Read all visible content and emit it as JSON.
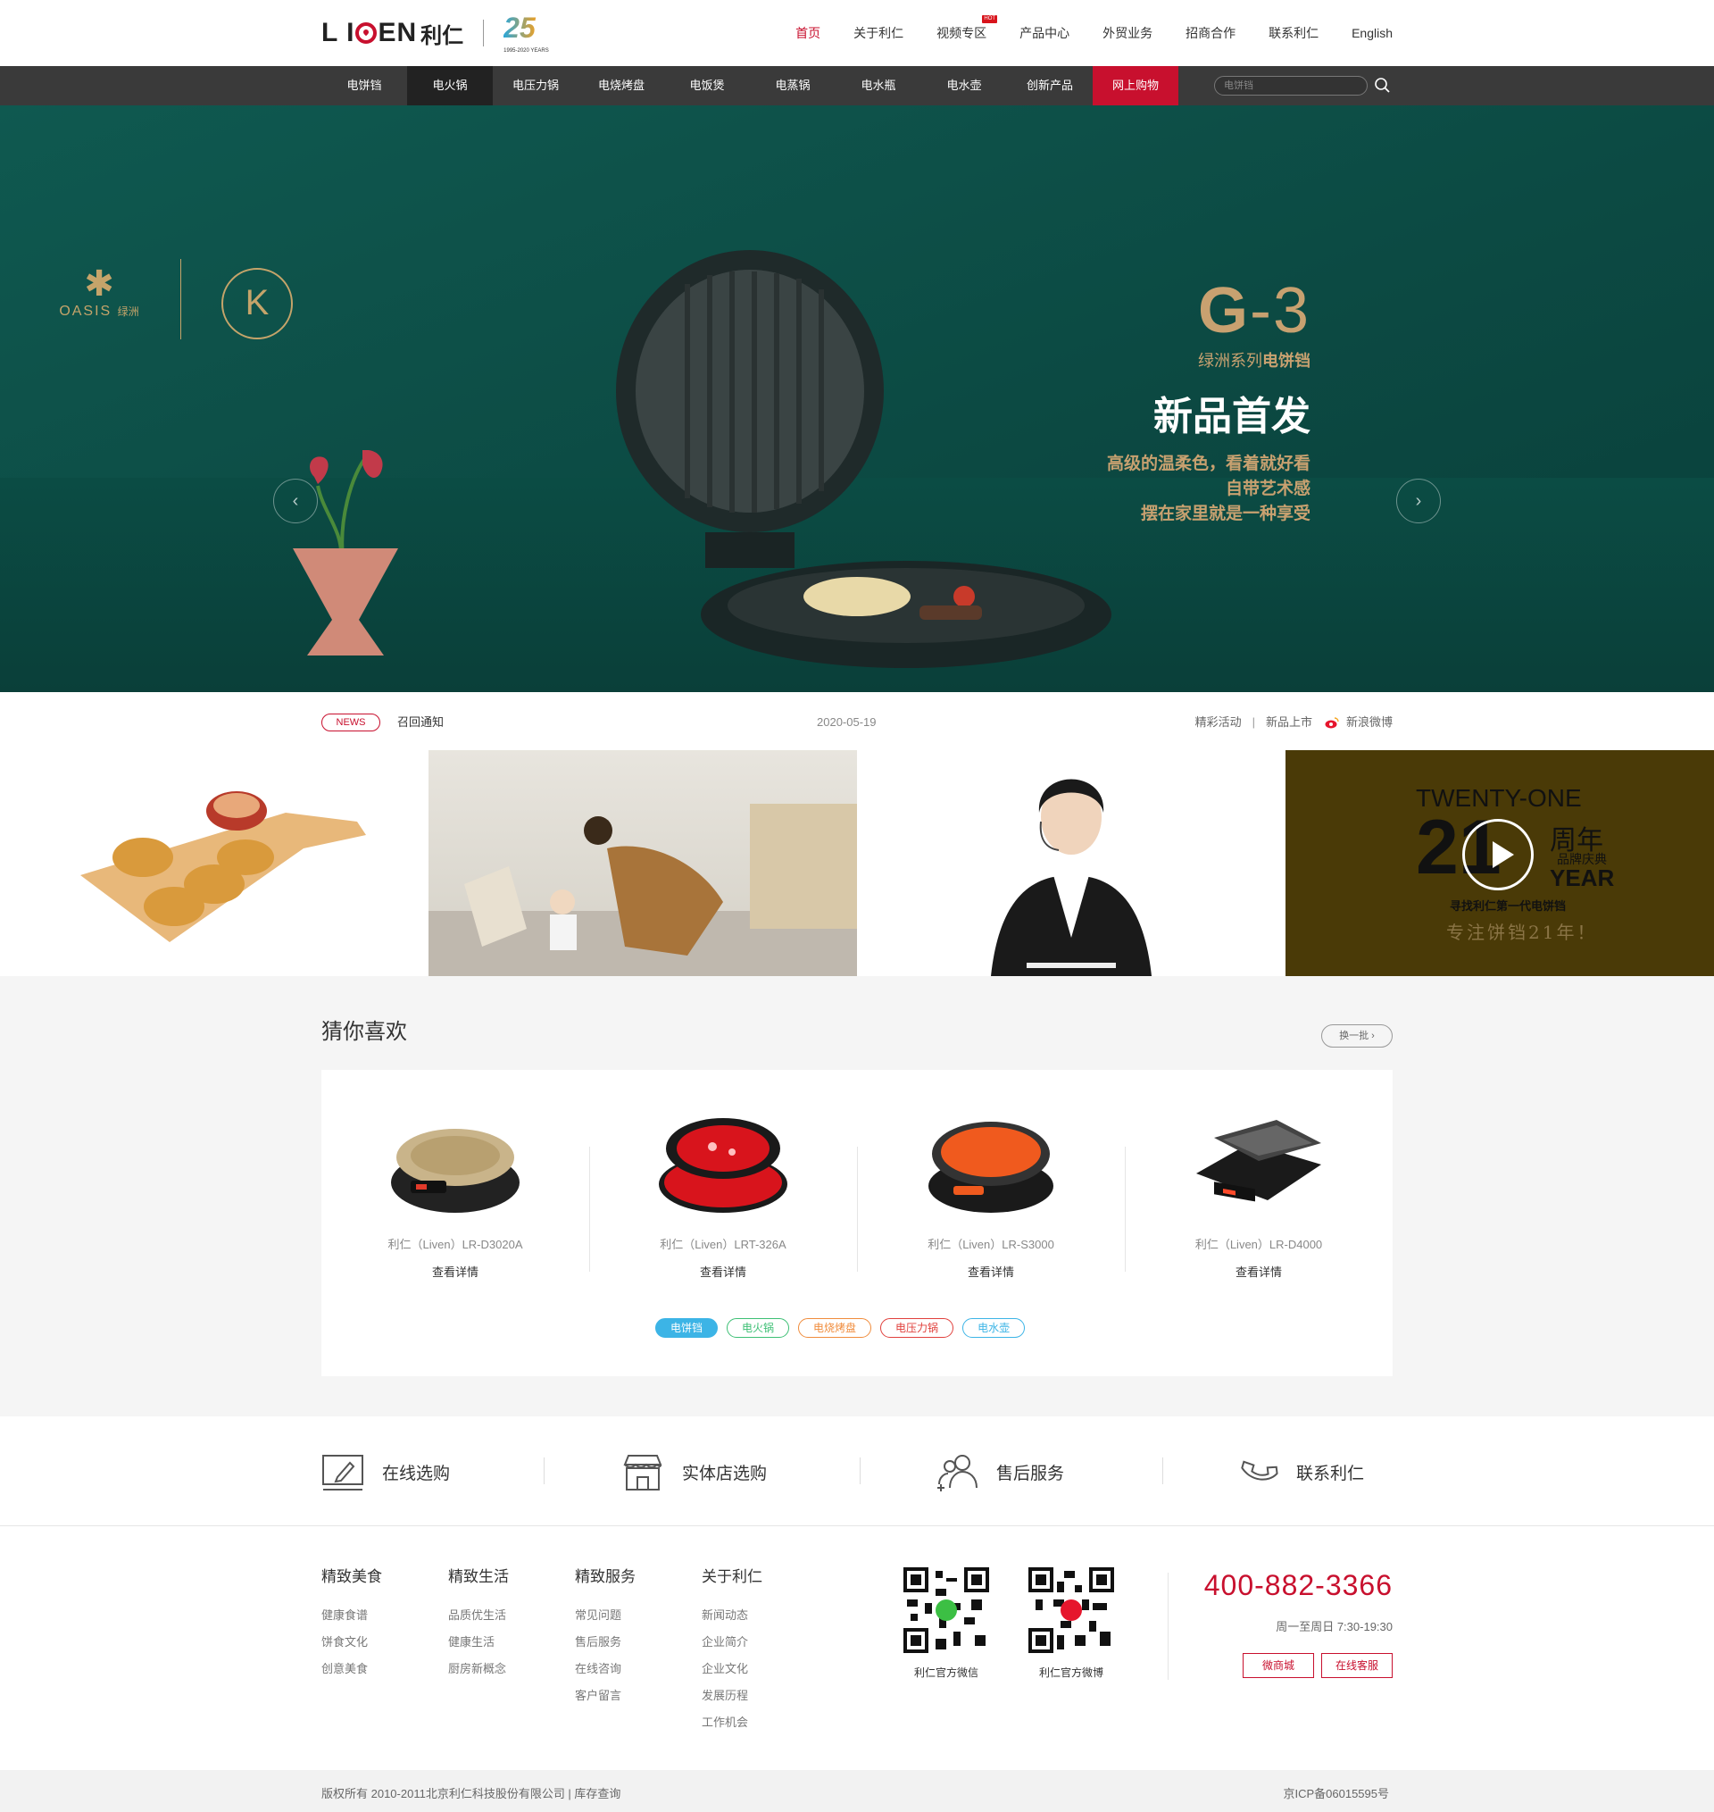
{
  "header": {
    "logo_text": "LIVEN",
    "logo_cn": "利仁",
    "anniversary_num": "25",
    "anniversary_sub": "1995-2020 YEARS",
    "nav": [
      {
        "label": "首页",
        "active": true
      },
      {
        "label": "关于利仁"
      },
      {
        "label": "视频专区",
        "badge": "HOT"
      },
      {
        "label": "产品中心"
      },
      {
        "label": "外贸业务"
      },
      {
        "label": "招商合作"
      },
      {
        "label": "联系利仁"
      },
      {
        "label": "English"
      }
    ]
  },
  "categories": [
    {
      "label": "电饼铛"
    },
    {
      "label": "电火锅",
      "active": true
    },
    {
      "label": "电压力锅"
    },
    {
      "label": "电烧烤盘"
    },
    {
      "label": "电饭煲"
    },
    {
      "label": "电蒸锅"
    },
    {
      "label": "电水瓶"
    },
    {
      "label": "电水壶"
    },
    {
      "label": "创新产品"
    },
    {
      "label": "网上购物",
      "highlight": true
    }
  ],
  "search": {
    "placeholder": "电饼铛"
  },
  "hero": {
    "brand_en": "OASIS",
    "brand_cn": "绿洲",
    "model_big": "G",
    "model_small": "-3",
    "series_prefix": "绿洲系列",
    "series_product": "电饼铛",
    "title": "新品首发",
    "lines": [
      "高级的温柔色，看着就好看",
      "自带艺术感",
      "摆在家里就是一种享受"
    ],
    "dot_count": 10,
    "active_dot": 0,
    "accent_color": "#c8a170",
    "bg_color": "#0d5249"
  },
  "news": {
    "tag": "NEWS",
    "title": "召回通知",
    "date": "2020-05-19",
    "links": [
      "精彩活动",
      "新品上市",
      "新浪微博"
    ]
  },
  "tiles": {
    "video": {
      "en": "TWENTY-ONE",
      "num": "21",
      "cn": "周年",
      "sub": "品牌庆典",
      "year": "YEAR",
      "line1": "寻找利仁第一代电饼铛",
      "line2": "专注饼铛21年！"
    }
  },
  "guess": {
    "title": "猜你喜欢",
    "refresh": "换一批 ›",
    "products": [
      {
        "name": "利仁（Liven）LR-D3020A",
        "link": "查看详情",
        "color": "#c9b48a"
      },
      {
        "name": "利仁（Liven）LRT-326A",
        "link": "查看详情",
        "color": "#d8141c"
      },
      {
        "name": "利仁（Liven）LR-S3000",
        "link": "查看详情",
        "color": "#f05a1e"
      },
      {
        "name": "利仁（Liven）LR-D4000",
        "link": "查看详情",
        "color": "#2a2a2a"
      }
    ],
    "pills": [
      {
        "label": "电饼铛",
        "color": "#3cb4e6",
        "filled": true
      },
      {
        "label": "电火锅",
        "color": "#3cbf74"
      },
      {
        "label": "电烧烤盘",
        "color": "#f08c3c"
      },
      {
        "label": "电压力锅",
        "color": "#e0403c"
      },
      {
        "label": "电水壶",
        "color": "#3cb4e6"
      }
    ]
  },
  "services": [
    {
      "label": "在线选购",
      "icon": "edit-icon"
    },
    {
      "label": "实体店选购",
      "icon": "store-icon"
    },
    {
      "label": "售后服务",
      "icon": "users-icon"
    },
    {
      "label": "联系利仁",
      "icon": "phone-icon"
    }
  ],
  "footer": {
    "columns": [
      {
        "title": "精致美食",
        "links": [
          "健康食谱",
          "饼食文化",
          "创意美食"
        ]
      },
      {
        "title": "精致生活",
        "links": [
          "品质优生活",
          "健康生活",
          "厨房新概念"
        ]
      },
      {
        "title": "精致服务",
        "links": [
          "常见问题",
          "售后服务",
          "在线咨询",
          "客户留言"
        ]
      },
      {
        "title": "关于利仁",
        "links": [
          "新闻动态",
          "企业简介",
          "企业文化",
          "发展历程",
          "工作机会"
        ]
      }
    ],
    "qr": [
      {
        "label": "利仁官方微信"
      },
      {
        "label": "利仁官方微博"
      }
    ],
    "phone": "400-882-3366",
    "hours": "周一至周日 7:30-19:30",
    "buttons": [
      "微商城",
      "在线客服"
    ],
    "brand_color": "#c8102e"
  },
  "copyright": {
    "left": "版权所有  2010-2011北京利仁科技股份有限公司 | 库存查询",
    "right": "京ICP备06015595号"
  }
}
